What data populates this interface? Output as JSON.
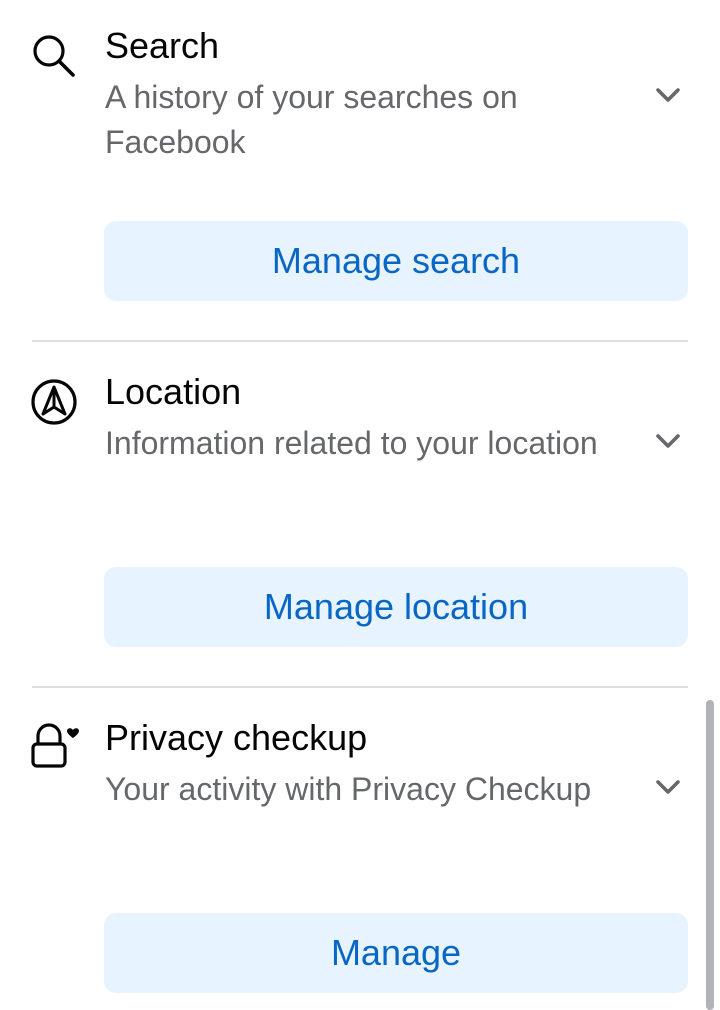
{
  "sections": [
    {
      "icon": "search-icon",
      "title": "Search",
      "description": "A history of your searches on Facebook",
      "button_label": "Manage search"
    },
    {
      "icon": "location-icon",
      "title": "Location",
      "description": "Information related to your location",
      "button_label": "Manage location"
    },
    {
      "icon": "lock-heart-icon",
      "title": "Privacy checkup",
      "description": "Your activity with Privacy Checkup",
      "button_label": "Manage"
    }
  ],
  "colors": {
    "title": "#050505",
    "description": "#65676b",
    "button_bg": "#e7f3ff",
    "button_text": "#0866c4",
    "divider": "#dddfe2"
  }
}
